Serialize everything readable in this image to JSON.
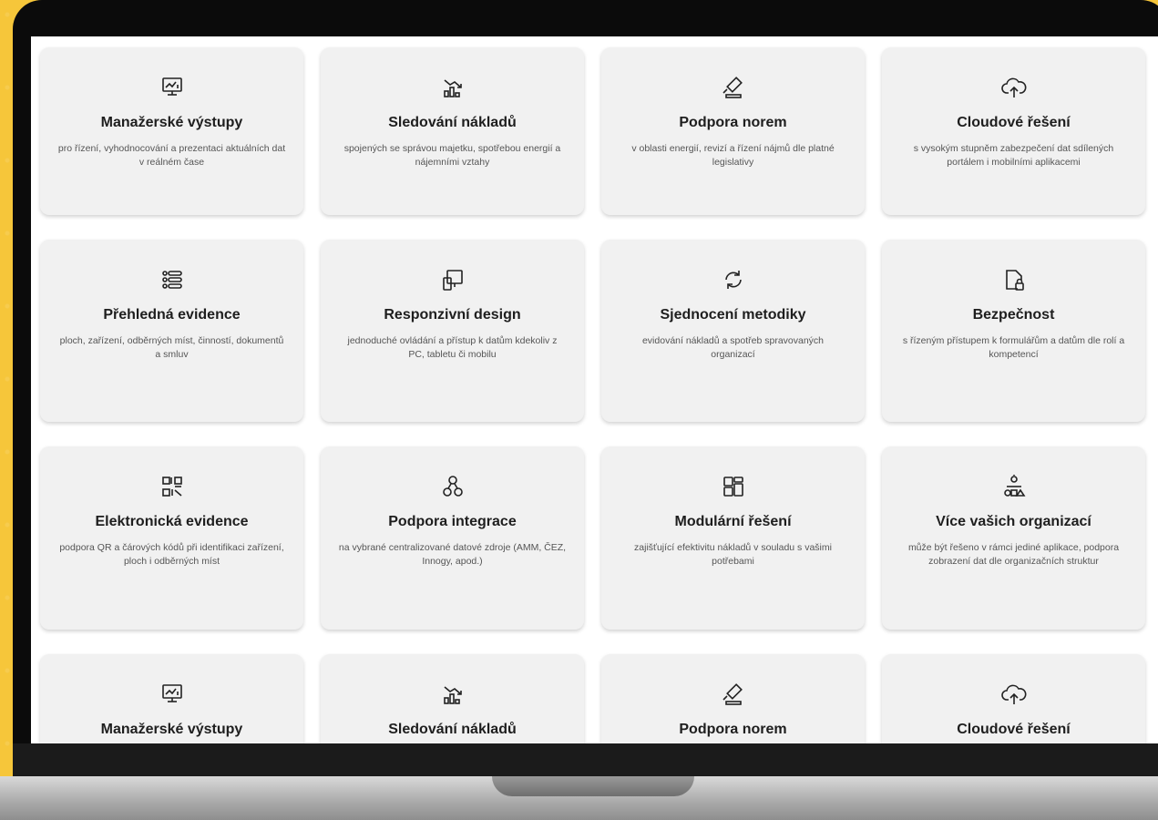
{
  "cards": [
    {
      "icon": "monitor-chart-icon",
      "title": "Manažerské výstupy",
      "desc": "pro řízení, vyhodnocování a prezentaci aktuálních dat v reálném čase"
    },
    {
      "icon": "bar-chart-down-icon",
      "title": "Sledování nákladů",
      "desc": "spojených se správou majetku, spotřebou energií a nájemními vztahy"
    },
    {
      "icon": "gavel-icon",
      "title": "Podpora norem",
      "desc": "v oblasti energií, revizí a řízení nájmů dle platné legislativy"
    },
    {
      "icon": "cloud-upload-icon",
      "title": "Cloudové řešení",
      "desc": "s vysokým stupněm zabezpečení dat sdílených portálem i mobilními aplikacemi"
    },
    {
      "icon": "list-icon",
      "title": "Přehledná evidence",
      "desc": "ploch, zařízení, odběrných míst, činností, dokumentů a smluv"
    },
    {
      "icon": "devices-icon",
      "title": "Responzivní design",
      "desc": "jednoduché ovládání a přístup k datům kdekoliv z PC, tabletu či mobilu"
    },
    {
      "icon": "sync-icon",
      "title": "Sjednocení metodiky",
      "desc": "evidování nákladů a spotřeb spravovaných organizací"
    },
    {
      "icon": "file-lock-icon",
      "title": "Bezpečnost",
      "desc": "s řízeným přístupem k formulářům a datům dle rolí a kompetencí"
    },
    {
      "icon": "qr-code-icon",
      "title": "Elektronická evidence",
      "desc": "podpora QR a čárových kódů při identifikaci zařízení, ploch i odběrných míst"
    },
    {
      "icon": "integration-icon",
      "title": "Podpora integrace",
      "desc": "na vybrané centralizované datové zdroje (AMM, ČEZ, Innogy, apod.)"
    },
    {
      "icon": "modules-icon",
      "title": "Modulární řešení",
      "desc": "zajišťující efektivitu nákladů v souladu s vašimi potřebami"
    },
    {
      "icon": "organization-icon",
      "title": "Více vašich organizací",
      "desc": "může být řešeno v rámci jediné aplikace, podpora zobrazení dat dle organizačních struktur"
    },
    {
      "icon": "monitor-chart-icon",
      "title": "Manažerské výstupy",
      "desc": ""
    },
    {
      "icon": "bar-chart-down-icon",
      "title": "Sledování nákladů",
      "desc": ""
    },
    {
      "icon": "gavel-icon",
      "title": "Podpora norem",
      "desc": ""
    },
    {
      "icon": "cloud-upload-icon",
      "title": "Cloudové řešení",
      "desc": ""
    }
  ]
}
